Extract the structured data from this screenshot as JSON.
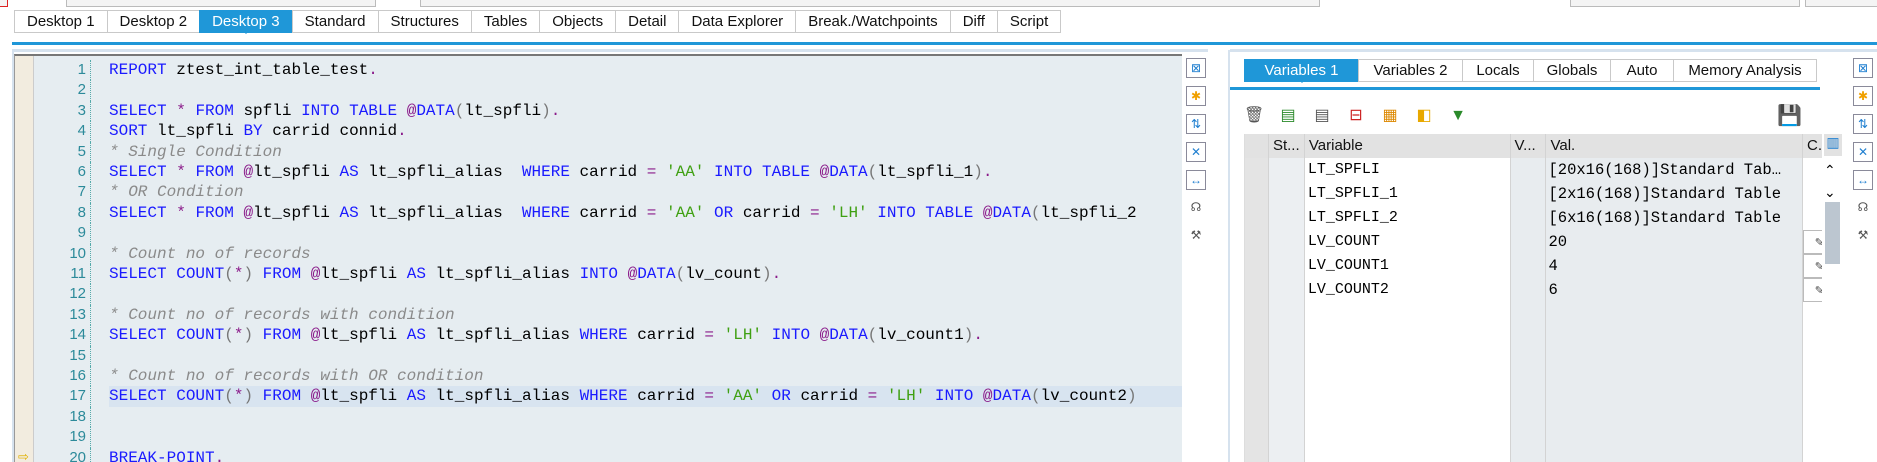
{
  "main_tabs": [
    "Desktop 1",
    "Desktop 2",
    "Desktop 3",
    "Standard",
    "Structures",
    "Tables",
    "Objects",
    "Detail",
    "Data Explorer",
    "Break./Watchpoints",
    "Diff",
    "Script"
  ],
  "active_main_tab": 2,
  "editor": {
    "lines": [
      "REPORT ztest_int_table_test.",
      "",
      "SELECT * FROM spfli INTO TABLE @DATA(lt_spfli).",
      "SORT lt_spfli BY carrid connid.",
      "* Single Condition",
      "SELECT * FROM @lt_spfli AS lt_spfli_alias  WHERE carrid = 'AA' INTO TABLE @DATA(lt_spfli_1).",
      "* OR Condition",
      "SELECT * FROM @lt_spfli AS lt_spfli_alias  WHERE carrid = 'AA' OR carrid = 'LH' INTO TABLE @DATA(lt_spfli_2",
      "",
      "* Count no of records",
      "SELECT COUNT(*) FROM @lt_spfli AS lt_spfli_alias INTO @DATA(lv_count).",
      "",
      "* Count no of records with condition",
      "SELECT COUNT(*) FROM @lt_spfli AS lt_spfli_alias WHERE carrid = 'LH' INTO @DATA(lv_count1).",
      "",
      "* Count no of records with OR condition",
      "SELECT COUNT(*) FROM @lt_spfli AS lt_spfli_alias WHERE carrid = 'AA' OR carrid = 'LH' INTO @DATA(lv_count2)",
      "",
      "",
      "BREAK-POINT."
    ],
    "highlighted_line": 17,
    "current_line": 20
  },
  "var_tabs": [
    "Variables 1",
    "Variables 2",
    "Locals",
    "Globals",
    "Auto",
    "Memory Analysis"
  ],
  "active_var_tab": 0,
  "table": {
    "headers": {
      "status": "St...",
      "variable": "Variable",
      "v": "V...",
      "value": "Val.",
      "c": "C."
    },
    "rows": [
      {
        "variable": "LT_SPFLI",
        "value": "[20x16(168)]Standard Tab…"
      },
      {
        "variable": "LT_SPFLI_1",
        "value": "[2x16(168)]Standard Table"
      },
      {
        "variable": "LT_SPFLI_2",
        "value": "[6x16(168)]Standard Table"
      },
      {
        "variable": "LV_COUNT",
        "value": "20"
      },
      {
        "variable": "LV_COUNT1",
        "value": "4"
      },
      {
        "variable": "LV_COUNT2",
        "value": "6"
      }
    ]
  },
  "colors": {
    "accent": "#1f97d8",
    "editor_bg": "#e6edf1",
    "keyword": "#1a1aff",
    "string": "#3fa012",
    "comment": "#8a8a8a"
  }
}
